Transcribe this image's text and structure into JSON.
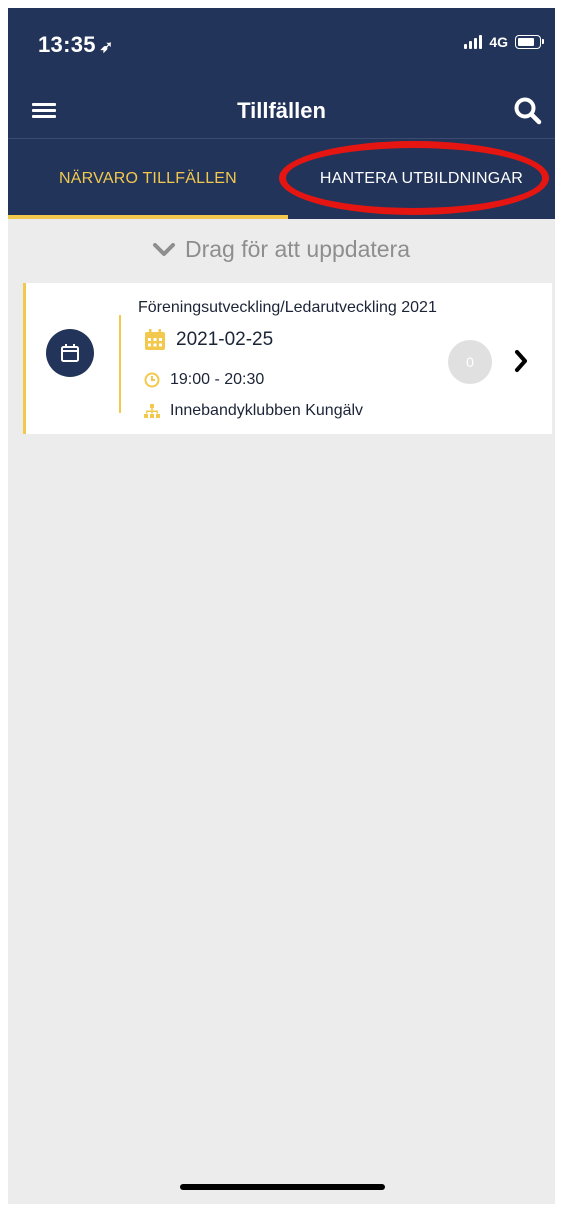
{
  "status_bar": {
    "time": "13:35",
    "network": "4G",
    "icons": [
      "location-arrow-icon",
      "signal-icon",
      "battery-icon"
    ]
  },
  "nav": {
    "title": "Tillfällen",
    "left_icon": "menu-icon",
    "right_icon": "search-icon"
  },
  "tabs": [
    {
      "label": "NÄRVARO TILLFÄLLEN",
      "active": true
    },
    {
      "label": "HANTERA UTBILDNINGAR",
      "active": false
    }
  ],
  "pull_to_refresh": {
    "label": "Drag för att uppdatera",
    "icon": "chevron-down-icon"
  },
  "sessions": [
    {
      "title": "Föreningsutveckling/Ledarutveckling 2021",
      "date": "2021-02-25",
      "time": "19:00 - 20:30",
      "organization": "Innebandyklubben Kungälv",
      "count": "0"
    }
  ],
  "colors": {
    "header_bg": "#23345a",
    "accent": "#f2c94c",
    "annotation_ring": "#e51612",
    "content_bg": "#ececec"
  }
}
